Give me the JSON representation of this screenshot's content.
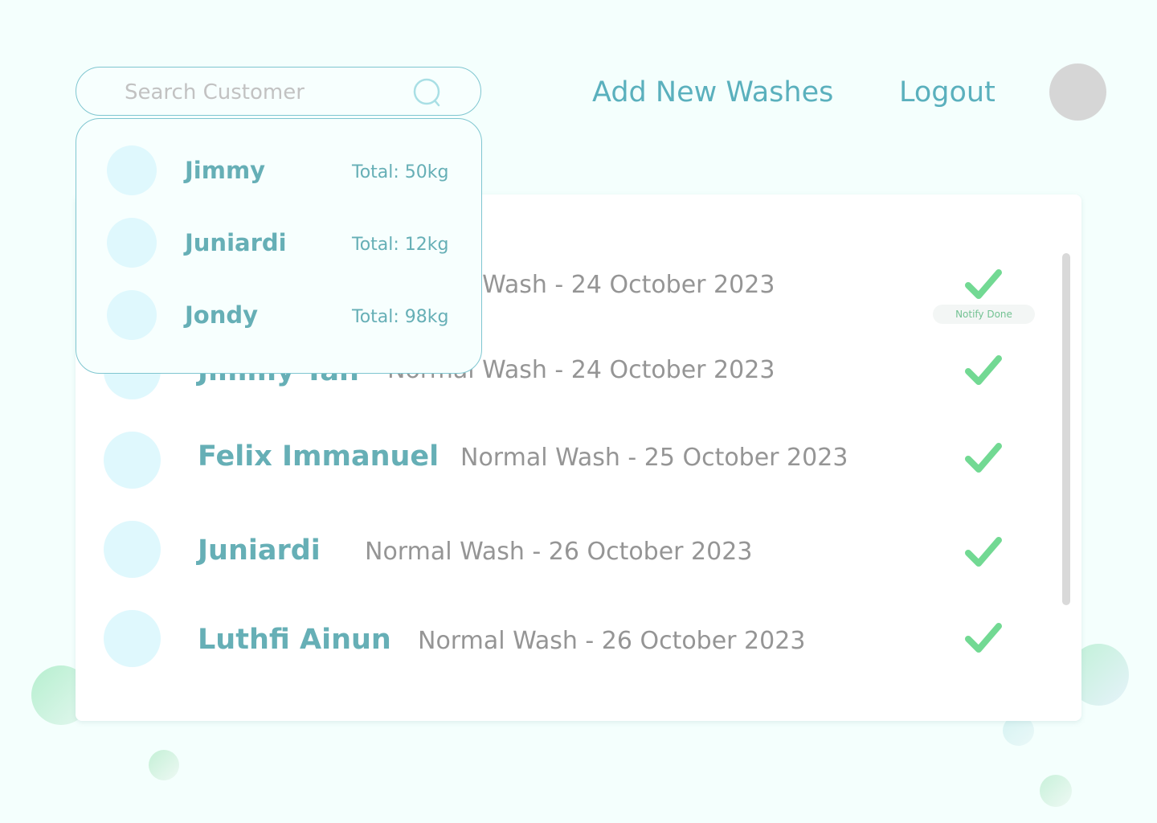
{
  "search": {
    "placeholder": "Search Customer"
  },
  "nav": {
    "add_new": "Add New Washes",
    "logout": "Logout"
  },
  "colors": {
    "accent": "#5ab0bd",
    "name": "#66afb6",
    "check": "#72d993",
    "background": "#f4fffd"
  },
  "dropdown": {
    "items": [
      {
        "name": "Jimmy",
        "total": "Total: 50kg"
      },
      {
        "name": "Juniardi",
        "total": "Total: 12kg"
      },
      {
        "name": "Jondy",
        "total": "Total: 98kg"
      }
    ]
  },
  "washes": {
    "rows": [
      {
        "name": "",
        "detail": "Normal Wash - 24 October 2023",
        "notify": "Notify Done",
        "status_icon": "checkmark-icon"
      },
      {
        "name": "Jimmy Tan",
        "detail": "Normal Wash - 24 October 2023",
        "status_icon": "checkmark-icon"
      },
      {
        "name": "Felix Immanuel",
        "detail": "Normal Wash - 25 October 2023",
        "status_icon": "checkmark-icon"
      },
      {
        "name": "Juniardi",
        "detail": "Normal Wash - 26 October 2023",
        "status_icon": "checkmark-icon"
      },
      {
        "name": "Luthfi Ainun",
        "detail": "Normal Wash - 26 October 2023",
        "status_icon": "checkmark-icon"
      }
    ]
  }
}
